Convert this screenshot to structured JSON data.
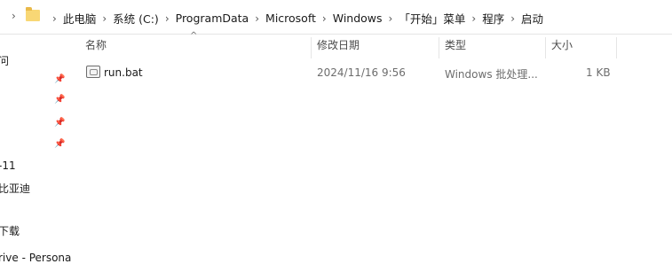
{
  "addressbar": {
    "breadcrumbs": [
      "此电脑",
      "系统 (C:)",
      "ProgramData",
      "Microsoft",
      "Windows",
      "「开始」菜单",
      "程序",
      "启动"
    ]
  },
  "nav": {
    "items": [
      "问",
      "-11",
      "比亚迪",
      "下载",
      "rive - Persona"
    ]
  },
  "columns": {
    "name": "名称",
    "modified": "修改日期",
    "type": "类型",
    "size": "大小"
  },
  "files": [
    {
      "name": "run.bat",
      "modified": "2024/11/16 9:56",
      "type": "Windows 批处理...",
      "size": "1 KB"
    }
  ],
  "icons": {
    "folder": "folder-icon",
    "pin": "pin-icon",
    "file": "bat-file-icon",
    "sort": "sort-up-icon"
  }
}
